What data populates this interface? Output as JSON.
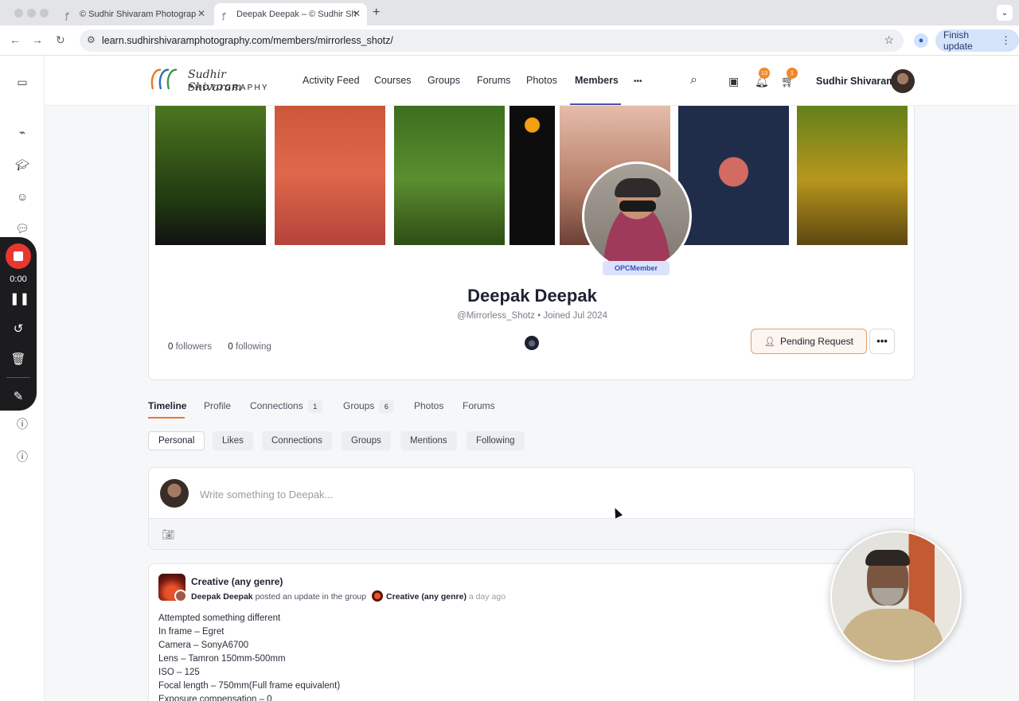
{
  "browser": {
    "tabs": [
      {
        "title": "© Sudhir Shivaram Photograp",
        "active": false
      },
      {
        "title": "Deepak Deepak – © Sudhir Sh",
        "active": true
      }
    ],
    "url": "learn.sudhirshivaramphotography.com/members/mirrorless_shotz/",
    "finish_update": "Finish update"
  },
  "recorder": {
    "time": "0:00"
  },
  "site": {
    "logo_name": "Sudhir Shivaram",
    "logo_sub": "PHOTOGRAPHY",
    "nav": [
      "Activity Feed",
      "Courses",
      "Groups",
      "Forums",
      "Photos",
      "Members"
    ],
    "nav_more": "•••",
    "notifications_count": "13",
    "cart_count": "1",
    "username": "Sudhir Shivaram"
  },
  "profile": {
    "role": "OPCMember",
    "name": "Deepak Deepak",
    "handle": "@Mirrorless_Shotz",
    "joined": "Joined Jul 2024",
    "followers": "0",
    "followers_label": "followers",
    "following": "0",
    "following_label": "following",
    "pending_label": "Pending Request"
  },
  "profile_tabs": [
    {
      "label": "Timeline"
    },
    {
      "label": "Profile"
    },
    {
      "label": "Connections",
      "count": "1"
    },
    {
      "label": "Groups",
      "count": "6"
    },
    {
      "label": "Photos"
    },
    {
      "label": "Forums"
    }
  ],
  "filters": [
    "Personal",
    "Likes",
    "Connections",
    "Groups",
    "Mentions",
    "Following"
  ],
  "composer": {
    "placeholder": "Write something to Deepak..."
  },
  "post": {
    "group": "Creative (any genre)",
    "author": "Deepak Deepak",
    "action": "posted an update in the group",
    "group_ref": "Creative (any genre)",
    "time_ago": "a day ago",
    "lines": [
      "Attempted something different",
      "In frame – Egret",
      "Camera – SonyA6700",
      "Lens – Tamron 150mm-500mm",
      "ISO – 125",
      "Focal length – 750mm(Full frame equivalent)",
      "Exposure compensation – 0"
    ]
  }
}
